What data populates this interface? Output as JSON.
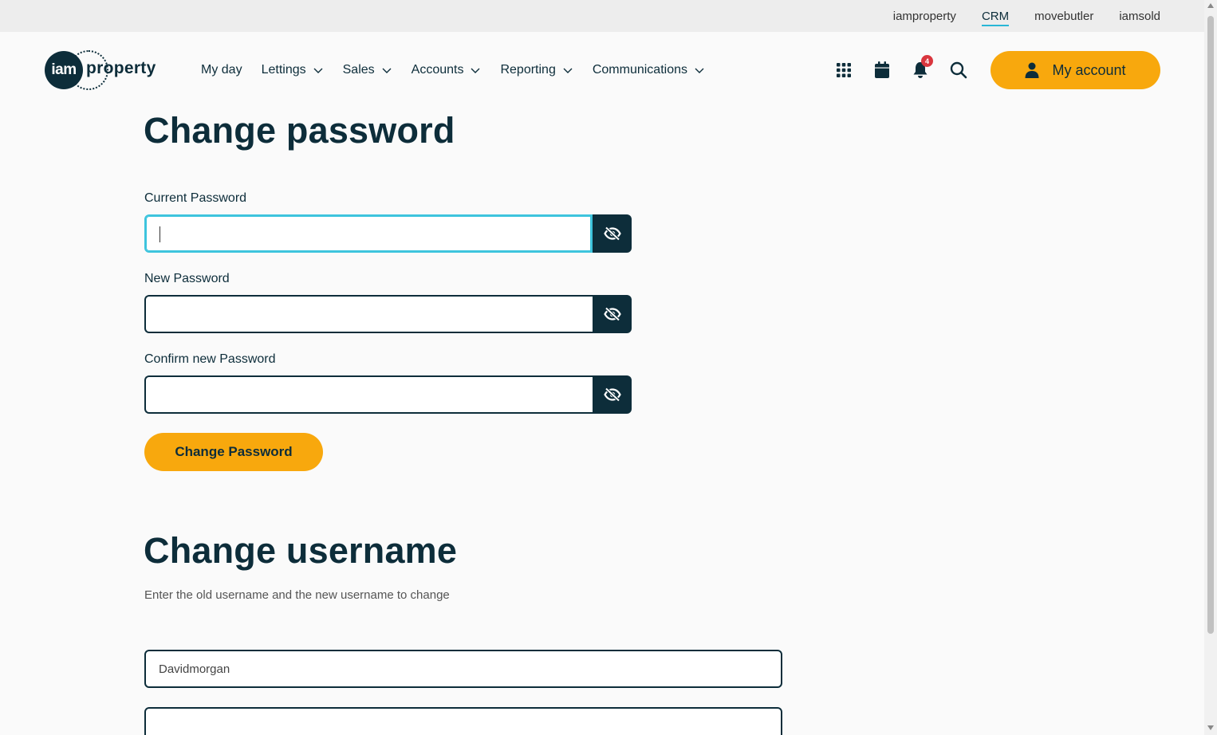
{
  "topbar": {
    "links": [
      {
        "label": "iamproperty",
        "active": false
      },
      {
        "label": "CRM",
        "active": true
      },
      {
        "label": "movebutler",
        "active": false
      },
      {
        "label": "iamsold",
        "active": false
      }
    ]
  },
  "logo": {
    "circle_text": "iam",
    "word": "property"
  },
  "nav": {
    "items": [
      {
        "label": "My day",
        "has_dropdown": false
      },
      {
        "label": "Lettings",
        "has_dropdown": true
      },
      {
        "label": "Sales",
        "has_dropdown": true
      },
      {
        "label": "Accounts",
        "has_dropdown": true
      },
      {
        "label": "Reporting",
        "has_dropdown": true
      },
      {
        "label": "Communications",
        "has_dropdown": true
      }
    ]
  },
  "header_icons": {
    "apps_icon": "grid-icon",
    "calendar_icon": "calendar-icon",
    "notifications_icon": "bell-icon",
    "notifications_count": "4",
    "search_icon": "search-icon"
  },
  "account": {
    "label": "My account",
    "icon": "user-icon"
  },
  "change_password": {
    "title": "Change password",
    "current_label": "Current Password",
    "current_value": "",
    "new_label": "New Password",
    "new_value": "",
    "confirm_label": "Confirm new Password",
    "confirm_value": "",
    "toggle_icon": "eye-slash-icon",
    "submit_label": "Change Password"
  },
  "change_username": {
    "title": "Change username",
    "description": "Enter the old username and the new username to change",
    "old_username_value": "Davidmorgan",
    "new_username_value": ""
  },
  "colors": {
    "brand_dark": "#0d2d3a",
    "accent": "#f8a80d",
    "focus": "#3dc4dd",
    "badge": "#d9363e"
  }
}
